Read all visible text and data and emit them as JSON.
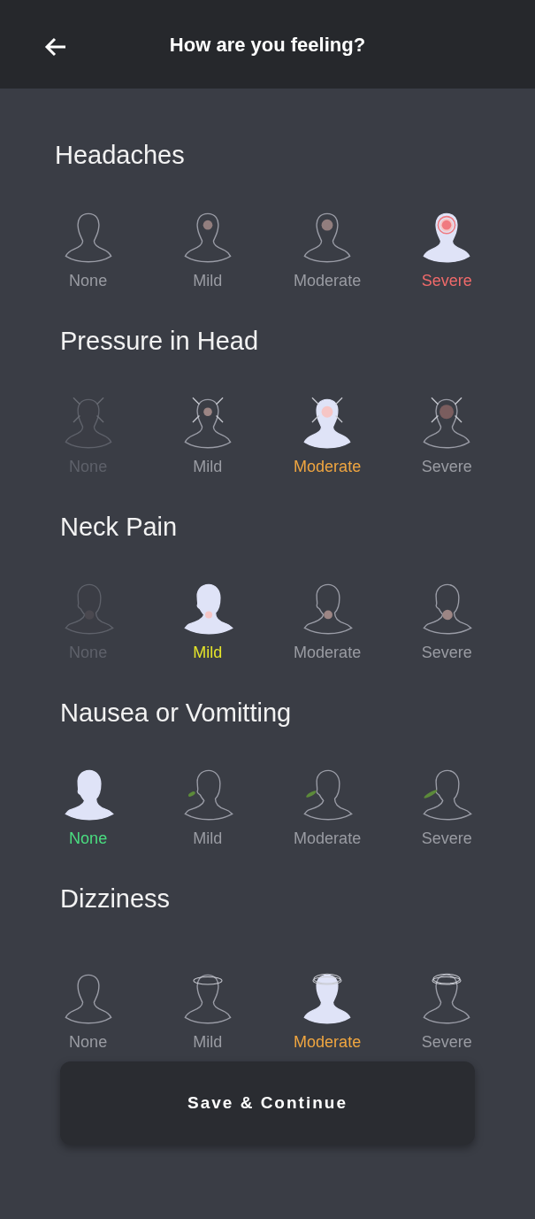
{
  "header": {
    "title": "How are you feeling?"
  },
  "sections": [
    {
      "title": "Headaches",
      "kind": "headache",
      "options": [
        {
          "label": "None",
          "selected": false
        },
        {
          "label": "Mild",
          "selected": false
        },
        {
          "label": "Moderate",
          "selected": false
        },
        {
          "label": "Severe",
          "selected": true
        }
      ]
    },
    {
      "title": "Pressure in Head",
      "kind": "pressure",
      "options": [
        {
          "label": "None",
          "selected": false
        },
        {
          "label": "Mild",
          "selected": false
        },
        {
          "label": "Moderate",
          "selected": true
        },
        {
          "label": "Severe",
          "selected": false
        }
      ]
    },
    {
      "title": "Neck Pain",
      "kind": "neck",
      "options": [
        {
          "label": "None",
          "selected": false
        },
        {
          "label": "Mild",
          "selected": true
        },
        {
          "label": "Moderate",
          "selected": false
        },
        {
          "label": "Severe",
          "selected": false
        }
      ]
    },
    {
      "title": "Nausea or Vomitting",
      "kind": "nausea",
      "options": [
        {
          "label": "None",
          "selected": true
        },
        {
          "label": "Mild",
          "selected": false
        },
        {
          "label": "Moderate",
          "selected": false
        },
        {
          "label": "Severe",
          "selected": false
        }
      ]
    },
    {
      "title": "Dizziness",
      "kind": "dizziness",
      "options": [
        {
          "label": "None",
          "selected": false
        },
        {
          "label": "Mild",
          "selected": false
        },
        {
          "label": "Moderate",
          "selected": true
        },
        {
          "label": "Severe",
          "selected": false
        }
      ]
    }
  ],
  "button": {
    "label": "Save & Continue"
  }
}
